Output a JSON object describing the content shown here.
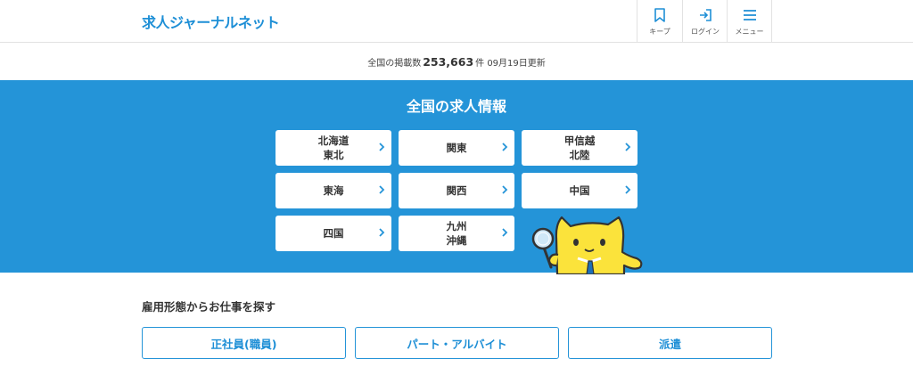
{
  "header": {
    "logo": "求人ジャーナルネット",
    "buttons": {
      "keep": "キープ",
      "login": "ログイン",
      "menu": "メニュー"
    }
  },
  "infobar": {
    "prefix": "全国の掲載数",
    "count": "253,663",
    "suffix": "件 09月19日更新"
  },
  "regions": {
    "title": "全国の求人情報",
    "items": [
      {
        "label": "北海道\n東北"
      },
      {
        "label": "関東"
      },
      {
        "label": "甲信越\n北陸"
      },
      {
        "label": "東海"
      },
      {
        "label": "関西"
      },
      {
        "label": "中国"
      },
      {
        "label": "四国"
      },
      {
        "label": "九州\n沖縄"
      }
    ]
  },
  "employment": {
    "title": "雇用形態からお仕事を探す",
    "types": [
      "正社員(職員)",
      "パート・アルバイト",
      "派遣"
    ]
  },
  "colors": {
    "brand_blue": "#2494d8",
    "mascot_yellow": "#fbe33b"
  }
}
